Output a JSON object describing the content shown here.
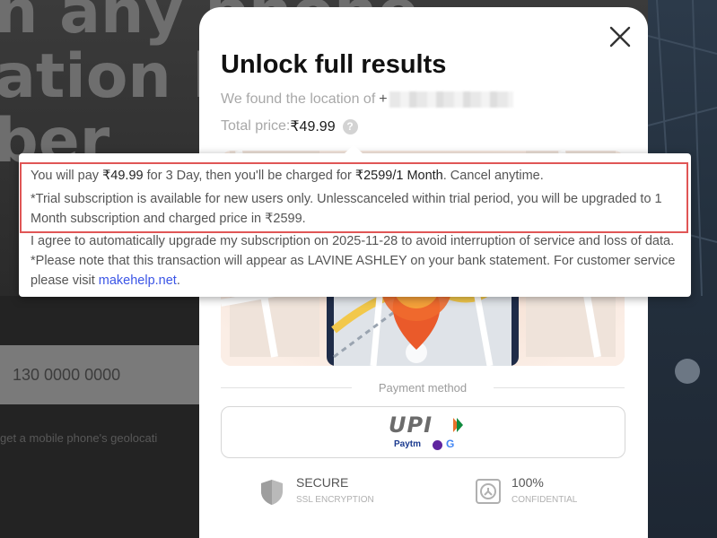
{
  "background": {
    "heading_lines": [
      "n any phone",
      "ation b",
      "ber"
    ],
    "input_value": "130 0000 0000",
    "caption": "get a mobile phone's geolocati"
  },
  "modal": {
    "title": "Unlock full results",
    "found_label": "We found the location of",
    "found_prefix": "+",
    "total_label": "Total price:",
    "total_value": "₹49.99",
    "help_icon": "question-circle-icon",
    "close_icon": "close-x-icon",
    "payment_method_label": "Payment method",
    "payment": {
      "logo_text": "UPI",
      "providers": [
        "Paytm",
        "PhonePe",
        "G"
      ]
    },
    "badges": [
      {
        "title": "SECURE",
        "subtitle": "SSL ENCRYPTION",
        "icon": "shield-icon"
      },
      {
        "title": "100%",
        "subtitle": "CONFIDENTIAL",
        "icon": "lock-icon"
      }
    ]
  },
  "tooltip": {
    "line1_pre": "You will pay ",
    "line1_price": "₹49.99",
    "line1_mid": " for 3 Day, then you'll be charged for ",
    "line1_renew": "₹2599/1 Month",
    "line1_post": ". Cancel anytime.",
    "line2": "*Trial subscription is available for new users only. Unlesscanceled within trial period, you will be upgraded to 1 Month subscription and charged price in ₹2599.",
    "line3_pre": "I agree to automatically upgrade my subscription on 2025-11-28 to avoid interruption of service and loss of data. *Please note that this transaction will appear as LAVINE ASHLEY on your bank statement. For customer service please visit ",
    "line3_link": "makehelp.net",
    "line3_post": ".",
    "highlight_color": "#e05656",
    "link_color": "#3b55e6"
  }
}
